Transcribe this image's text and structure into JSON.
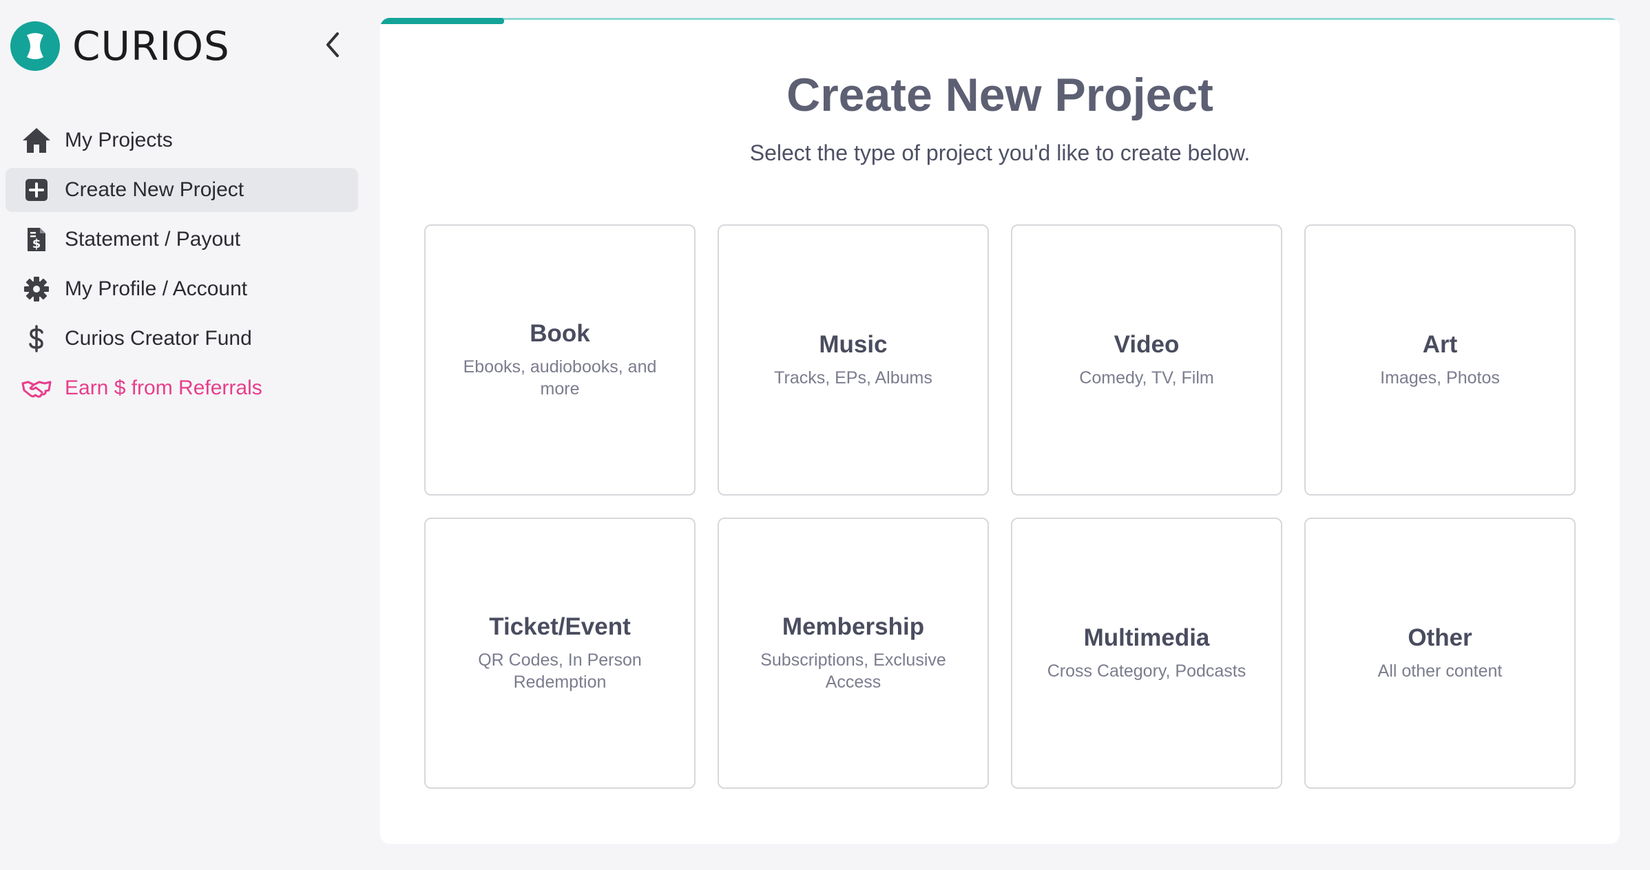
{
  "app": {
    "name": "CURIOS",
    "accent": "#14a398",
    "referral_color": "#e83e8c"
  },
  "sidebar": {
    "items": [
      {
        "label": "My Projects",
        "icon": "home-icon",
        "active": false
      },
      {
        "label": "Create New Project",
        "icon": "plus-square-icon",
        "active": true
      },
      {
        "label": "Statement / Payout",
        "icon": "invoice-dollar-icon",
        "active": false
      },
      {
        "label": "My Profile / Account",
        "icon": "gear-icon",
        "active": false
      },
      {
        "label": "Curios Creator Fund",
        "icon": "dollar-icon",
        "active": false
      },
      {
        "label": "Earn $ from Referrals",
        "icon": "handshake-icon",
        "active": false
      }
    ]
  },
  "main": {
    "progress_fraction": 0.1,
    "title": "Create New Project",
    "subtitle": "Select the type of project you'd like to create below.",
    "cards": [
      {
        "title": "Book",
        "desc": "Ebooks, audiobooks, and more"
      },
      {
        "title": "Music",
        "desc": "Tracks, EPs, Albums"
      },
      {
        "title": "Video",
        "desc": "Comedy, TV, Film"
      },
      {
        "title": "Art",
        "desc": "Images, Photos"
      },
      {
        "title": "Ticket/Event",
        "desc": "QR Codes, In Person Redemption"
      },
      {
        "title": "Membership",
        "desc": "Subscriptions, Exclusive Access"
      },
      {
        "title": "Multimedia",
        "desc": "Cross Category, Podcasts"
      },
      {
        "title": "Other",
        "desc": "All other content"
      }
    ]
  }
}
